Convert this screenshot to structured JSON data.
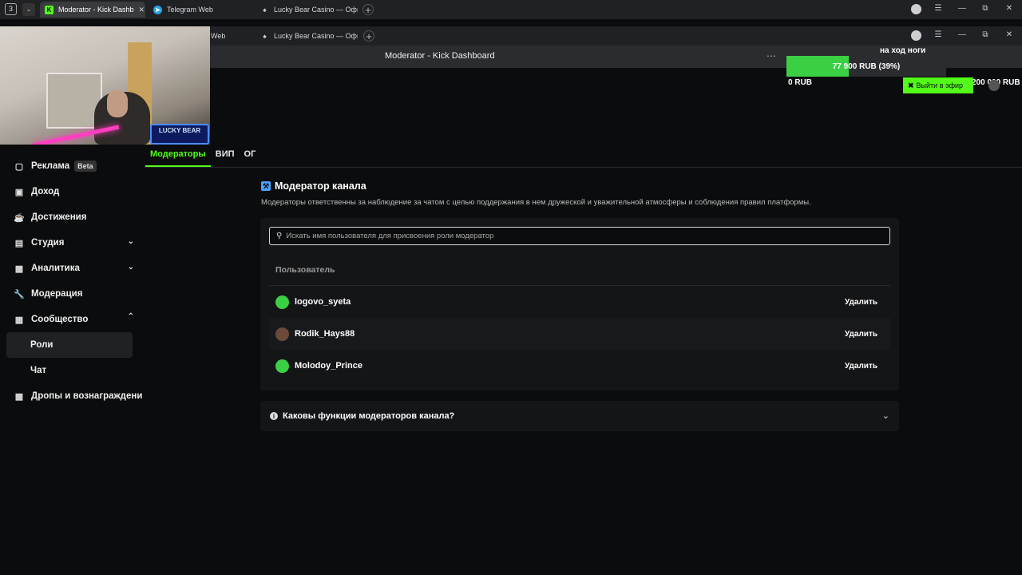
{
  "browser": {
    "tab_count": "3",
    "tabs": [
      {
        "label": "Moderator - Kick Dashb"
      },
      {
        "label": "Telegram Web"
      },
      {
        "label": "Lucky Bear Casino — Офи"
      }
    ],
    "tabs_second": [
      {
        "label": "Web"
      },
      {
        "label": "Lucky Bear Casino — Офи"
      }
    ],
    "window_title": "Moderator - Kick Dashboard"
  },
  "overlay": {
    "logo_text": "LUCKY BEAR",
    "goal_title": "на ход ноги",
    "goal_progress_text": "77 900 RUB (39%)",
    "goal_progress_percent": 39,
    "goal_min": "0 RUB",
    "goal_max": "200 000 RUB",
    "go_live_label": "Выйти в эфир",
    "accent_green": "#53fc18",
    "goal_green": "#3bcf44"
  },
  "role_tabs": [
    {
      "label": "Модераторы",
      "active": true
    },
    {
      "label": "ВИП",
      "active": false
    },
    {
      "label": "ОГ",
      "active": false
    }
  ],
  "sidebar": {
    "items": [
      {
        "label": "Реклама",
        "badge": "Beta",
        "icon": "ad-icon"
      },
      {
        "label": "Доход",
        "icon": "wallet-icon"
      },
      {
        "label": "Достижения",
        "icon": "trophy-icon"
      },
      {
        "label": "Студия",
        "icon": "studio-icon"
      },
      {
        "label": "Аналитика",
        "icon": "analytics-icon"
      },
      {
        "label": "Модерация",
        "icon": "wrench-icon"
      },
      {
        "label": "Сообщество",
        "icon": "community-icon"
      },
      {
        "label": "Роли"
      },
      {
        "label": "Чат"
      },
      {
        "label": "Дропы и вознаграждени",
        "icon": "gift-icon"
      }
    ]
  },
  "main": {
    "title": "Модератор канала",
    "description": "Модераторы ответственны за наблюдение за чатом с целью поддержания в нем дружеской и уважительной атмосферы и соблюдения правил платформы.",
    "search_placeholder": "Искать имя пользователя для присвоения роли модератор",
    "column_header": "Пользователь",
    "moderators": [
      {
        "username": "logovo_syeta",
        "action": "Удалить"
      },
      {
        "username": "Rodik_Hays88",
        "action": "Удалить"
      },
      {
        "username": "Molodoy_Prince",
        "action": "Удалить"
      }
    ],
    "faq_title": "Каковы функции модераторов канала?"
  }
}
